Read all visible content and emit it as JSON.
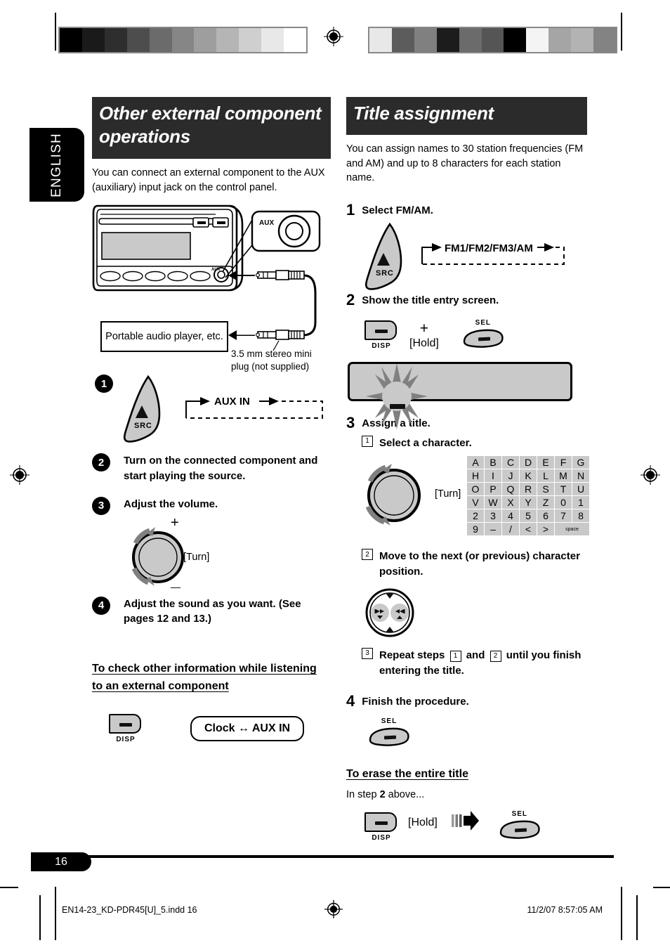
{
  "page": {
    "language_tab": "ENGLISH",
    "number": "16",
    "footer_file": "EN14-23_KD-PDR45[U]_5.indd   16",
    "footer_timestamp": "11/2/07   8:57:05 AM"
  },
  "left": {
    "heading": "Other external component operations",
    "intro": "You can connect an external component to the AUX (auxiliary) input jack on the control panel.",
    "diagram": {
      "aux_label": "AUX",
      "aux_jack_small_label": "AUX",
      "player_box": "Portable audio player, etc.",
      "plug_caption": "3.5 mm stereo mini plug (not supplied)"
    },
    "steps": [
      {
        "num": "1",
        "text": "",
        "src_label": "SRC",
        "flow": "AUX IN"
      },
      {
        "num": "2",
        "text": "Turn on the connected component and start playing the source."
      },
      {
        "num": "3",
        "text": "Adjust the volume.",
        "knob_plus": "+",
        "knob_minus": "—",
        "knob_hint": "[Turn]"
      },
      {
        "num": "4",
        "text": "Adjust the sound as you want. (See pages 12 and 13.)"
      }
    ],
    "subsection": {
      "heading_line1": "To check other information while listening",
      "heading_line2": "to an external component",
      "disp_label": "DISP",
      "result_pill": "Clock ↔ AUX IN"
    }
  },
  "right": {
    "heading": "Title assignment",
    "intro": "You can assign names to 30 station frequencies (FM and AM) and up to 8 characters for each station name.",
    "steps": [
      {
        "num": "1",
        "text": "Select FM/AM.",
        "src_label": "SRC",
        "flow": "FM1/FM2/FM3/AM"
      },
      {
        "num": "2",
        "text": "Show the title entry screen.",
        "disp_label": "DISP",
        "plus": "+",
        "hold": "[Hold]",
        "sel_label": "SEL"
      },
      {
        "num": "3",
        "text": "Assign a title.",
        "substeps": [
          {
            "num": "1",
            "text": "Select a character.",
            "knob_hint": "[Turn]"
          },
          {
            "num": "2",
            "text": "Move to the next (or previous) character position."
          },
          {
            "num": "3",
            "text_a": "Repeat steps",
            "ref_a": "1",
            "text_b": "and",
            "ref_b": "2",
            "text_c": "until you finish entering the title."
          }
        ]
      },
      {
        "num": "4",
        "text": "Finish the procedure.",
        "sel_label": "SEL"
      }
    ],
    "character_grid": {
      "rows": [
        [
          "A",
          "B",
          "C",
          "D",
          "E",
          "F",
          "G"
        ],
        [
          "H",
          "I",
          "J",
          "K",
          "L",
          "M",
          "N"
        ],
        [
          "O",
          "P",
          "Q",
          "R",
          "S",
          "T",
          "U"
        ],
        [
          "V",
          "W",
          "X",
          "Y",
          "Z",
          "0",
          "1"
        ],
        [
          "2",
          "3",
          "4",
          "5",
          "6",
          "7",
          "8"
        ],
        [
          "9",
          "–",
          "/",
          "<",
          ">",
          "space"
        ]
      ]
    },
    "erase": {
      "heading": "To erase the entire title",
      "lead_a": "In step",
      "lead_num": "2",
      "lead_b": "above...",
      "disp_label": "DISP",
      "hold": "[Hold]",
      "sel_label": "SEL"
    }
  },
  "calibration": {
    "left_bar": [
      "#000000",
      "#1a1a1a",
      "#2e2e2e",
      "#4d4d4d",
      "#6b6b6b",
      "#868686",
      "#9e9e9e",
      "#b5b5b5",
      "#cfcfcf",
      "#e8e8e8",
      "#ffffff"
    ],
    "right_bar": [
      "#e8e8e8",
      "#5c5c5c",
      "#808080",
      "#1c1c1c",
      "#6b6b6b",
      "#555555",
      "#000000",
      "#f4f4f4",
      "#a5a5a5",
      "#b3b3b3",
      "#838383"
    ]
  },
  "colors": {
    "heading_bg": "#2b2b2b",
    "button_gray": "#c9c9c9",
    "ink": "#000000"
  }
}
